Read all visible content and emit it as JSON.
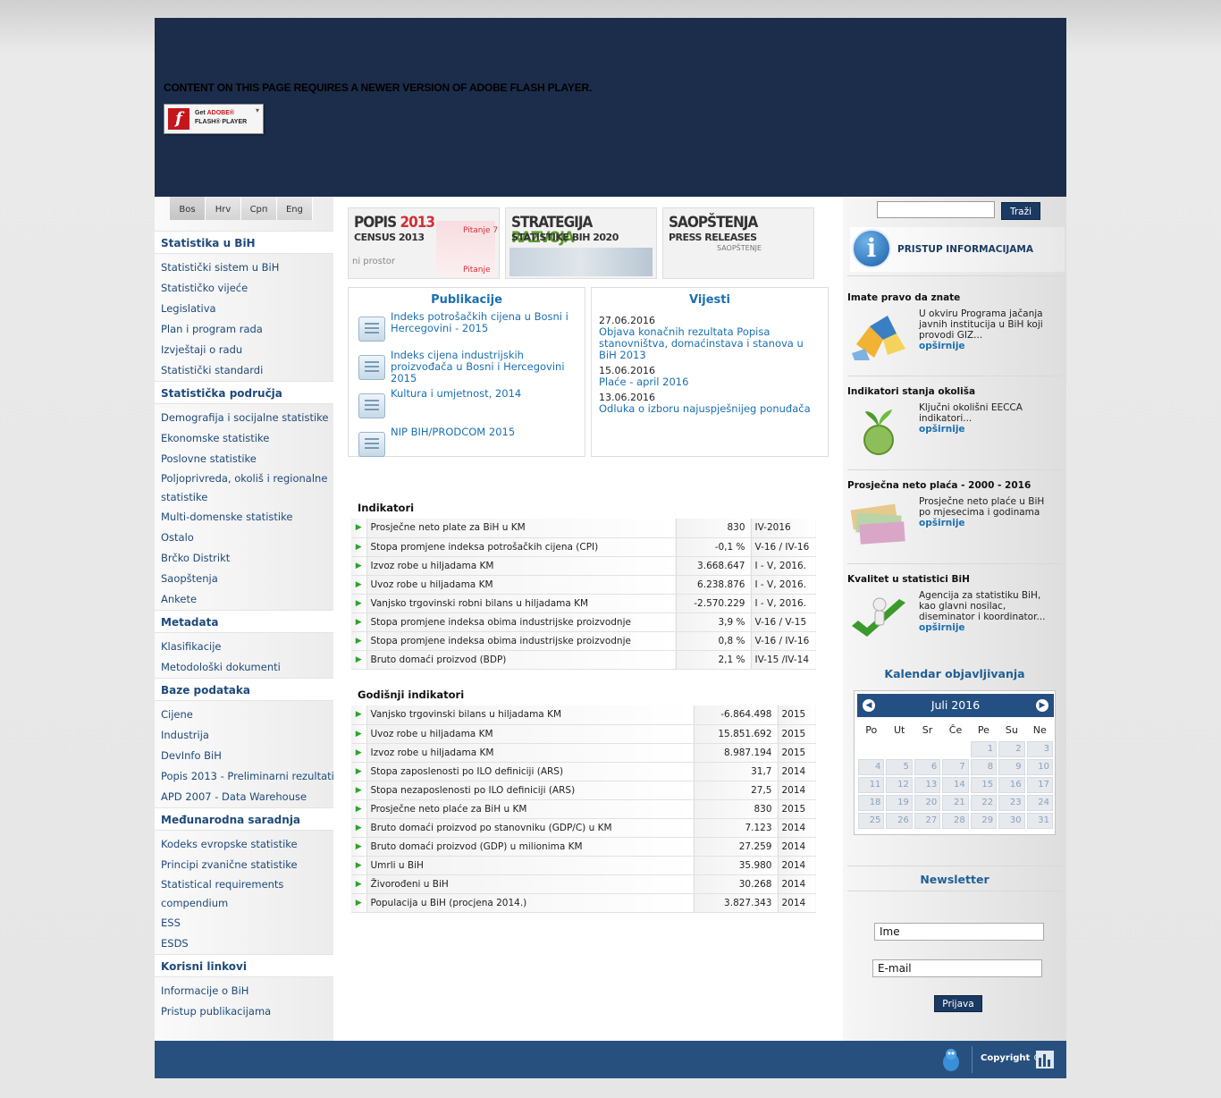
{
  "flash": {
    "message": "CONTENT ON THIS PAGE REQUIRES A NEWER VERSION OF ADOBE FLASH PLAYER.",
    "button_line1_prefix": "Get ",
    "button_line1_brand": "ADOBE®",
    "button_line2": "FLASH® PLAYER"
  },
  "languages": [
    "Bos",
    "Hrv",
    "Срп",
    "Eng"
  ],
  "left_nav": [
    {
      "heading": "Statistika u BiH",
      "items": [
        "Statistički sistem u BiH",
        "Statističko vijeće",
        "Legislativa",
        "Plan i program rada",
        "Izvještaji o radu",
        "Statistički standardi"
      ]
    },
    {
      "heading": "Statistička područja",
      "items": [
        "Demografija i socijalne statistike",
        "Ekonomske statistike",
        "Poslovne statistike",
        "Poljoprivreda, okoliš i regionalne statistike",
        "Multi-domenske statistike",
        "Ostalo",
        "Brčko Distrikt",
        "Saopštenja",
        "Ankete"
      ]
    },
    {
      "heading": "Metadata",
      "items": [
        "Klasifikacije",
        "Metodološki dokumenti"
      ]
    },
    {
      "heading": "Baze podataka",
      "items": [
        "Cijene",
        "Industrija",
        "DevInfo BiH",
        "Popis 2013 - Preliminarni rezultati",
        "APD 2007 - Data Warehouse"
      ]
    },
    {
      "heading": "Međunarodna saradnja",
      "items": [
        "Kodeks evropske statistike",
        "Principi zvanične statistike",
        "Statistical requirements compendium",
        "ESS",
        "ESDS"
      ]
    },
    {
      "heading": "Korisni linkovi",
      "items": [
        "Informacije o BiH",
        "Pristup publikacijama"
      ]
    }
  ],
  "banners": {
    "popis": {
      "title_a": "POPIS ",
      "title_b": "2013",
      "sub": "CENSUS 2013",
      "side1": "Pitanje 7",
      "side2": "ni prostor",
      "side3": "Pitanje"
    },
    "strategija": {
      "title_a": "STRATEGIJA ",
      "title_b": "RAZVOJA",
      "sub": "STATISTIKE BIH 2020"
    },
    "saopstenja": {
      "title": "SAOPŠTENJA",
      "sub": "PRESS RELEASES",
      "side": "SAOPŠTENJE"
    }
  },
  "publikacije": {
    "title": "Publikacije",
    "items": [
      "Indeks potrošačkih cijena u Bosni i Hercegovini - 2015",
      "Indeks cijena industrijskih proizvođača u Bosni i Hercegovini 2015",
      "Kultura i umjetnost, 2014",
      "NIP BIH/PRODCOM 2015"
    ]
  },
  "vijesti": {
    "title": "Vijesti",
    "items": [
      {
        "date": "27.06.2016",
        "text": "Objava konačnih rezultata Popisa stanovništva, domaćinstava i stanova u BiH 2013"
      },
      {
        "date": "15.06.2016",
        "text": "Plaće - april 2016"
      },
      {
        "date": "13.06.2016",
        "text": "Odluka o izboru najuspješnijeg ponuđača"
      }
    ]
  },
  "indikatori": {
    "title": "Indikatori",
    "rows": [
      {
        "name": "Prosječne neto plate za BiH u KM",
        "value": "830",
        "period": "IV-2016"
      },
      {
        "name": "Stopa promjene indeksa potrošačkih cijena (CPI)",
        "value": "-0,1 %",
        "period": "V-16 / IV-16"
      },
      {
        "name": "Izvoz robe u hiljadama KM",
        "value": "3.668.647",
        "period": "I - V, 2016."
      },
      {
        "name": "Uvoz robe u hiljadama KM",
        "value": "6.238.876",
        "period": "I - V, 2016."
      },
      {
        "name": "Vanjsko trgovinski robni bilans u hiljadama KM",
        "value": "-2.570.229",
        "period": "I - V, 2016."
      },
      {
        "name": "Stopa promjene indeksa obima industrijske proizvodnje",
        "value": "3,9 %",
        "period": "V-16 / V-15"
      },
      {
        "name": "Stopa promjene indeksa obima industrijske proizvodnje",
        "value": "0,8 %",
        "period": "V-16 / IV-16"
      },
      {
        "name": "Bruto domaći proizvod (BDP)",
        "value": "2,1 %",
        "period": "IV-15 /IV-14"
      }
    ]
  },
  "godisnji": {
    "title": "Godišnji indikatori",
    "rows": [
      {
        "name": "Vanjsko trgovinski bilans u hiljadama KM",
        "value": "-6.864.498",
        "period": "2015"
      },
      {
        "name": "Uvoz robe u hiljadama KM",
        "value": "15.851.692",
        "period": "2015"
      },
      {
        "name": "Izvoz robe u hiljadama KM",
        "value": "8.987.194",
        "period": "2015"
      },
      {
        "name": "Stopa zaposlenosti po ILO definiciji (ARS)",
        "value": "31,7",
        "period": "2014"
      },
      {
        "name": "Stopa nezaposlenosti po ILO definiciji (ARS)",
        "value": "27,5",
        "period": "2014"
      },
      {
        "name": "Prosječne neto plaće za BiH u KM",
        "value": "830",
        "period": "2015"
      },
      {
        "name": "Bruto domaći proizvod po stanovniku (GDP/C) u KM",
        "value": "7.123",
        "period": "2014"
      },
      {
        "name": "Bruto domaći proizvod (GDP) u milionima KM",
        "value": "27.259",
        "period": "2014"
      },
      {
        "name": "Umrli u BiH",
        "value": "35.980",
        "period": "2014"
      },
      {
        "name": "Živorođeni u BiH",
        "value": "30.268",
        "period": "2014"
      },
      {
        "name": "Populacija u BiH (procjena 2014.)",
        "value": "3.827.343",
        "period": "2014"
      }
    ]
  },
  "search": {
    "button": "Traži"
  },
  "pristup": {
    "label": "PRISTUP INFORMACIJAMA",
    "icon": "info-icon"
  },
  "features": [
    {
      "title": "Imate pravo da znate",
      "text": "U okviru Programa jačanja javnih institucija u BiH koji provodi GIZ...",
      "more": "opširnije",
      "icon": "puzzle-icon"
    },
    {
      "title": "Indikatori stanja okoliša",
      "text": "Ključni okolišni EECCA indikatori...",
      "more": "opširnije",
      "icon": "globe-plant-icon"
    },
    {
      "title": "Prosječna neto plaća - 2000 - 2016",
      "text": "Prosječne neto plaće u BiH po mjesecima i godinama",
      "more": "opširnije",
      "icon": "money-icon"
    },
    {
      "title": "Kvalitet u statistici BiH",
      "text": "Agencija za statistiku BiH, kao glavni nosilac, diseminator i koordinator...",
      "more": "opširnije",
      "icon": "checkmark-figure-icon"
    }
  ],
  "calendar": {
    "title": "Kalendar objavljivanja",
    "month": "Juli 2016",
    "weekdays": [
      "Po",
      "Ut",
      "Sr",
      "Če",
      "Pe",
      "Su",
      "Ne"
    ],
    "leading_blanks": 4,
    "days": 31
  },
  "newsletter": {
    "title": "Newsletter",
    "name_value": "Ime",
    "email_value": "E-mail",
    "button": "Prijava"
  },
  "footer": {
    "copyright": "Copyright ©"
  },
  "colors": {
    "header_bg": "#1b2d4a",
    "footer_bg": "#28507f",
    "link": "#1a6fb0",
    "nav_heading": "#1e4a7a",
    "arrow": "#2aa52a"
  }
}
